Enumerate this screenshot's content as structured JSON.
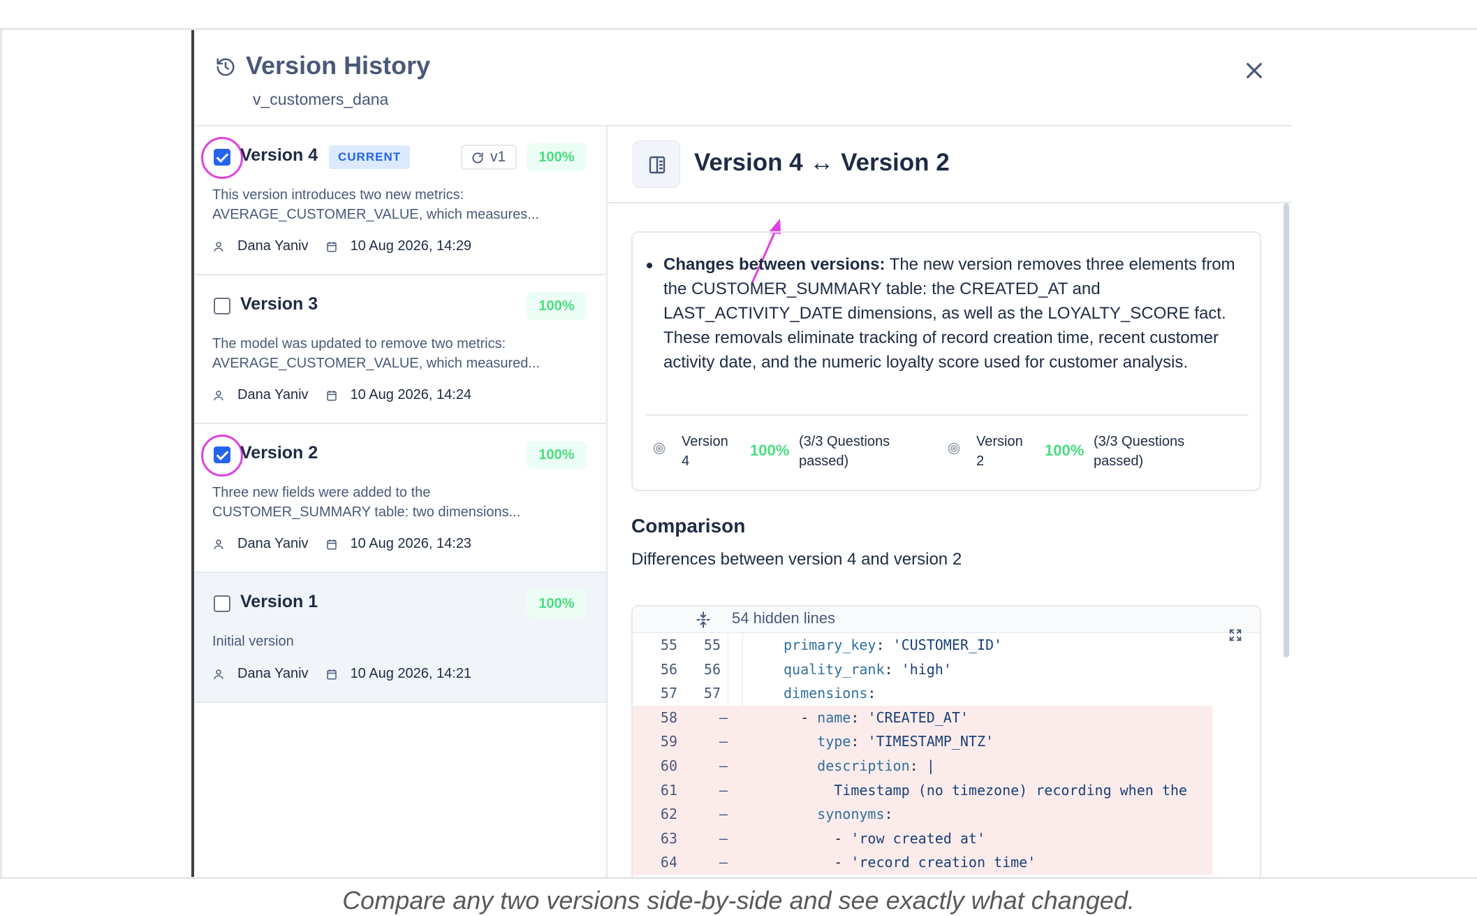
{
  "header": {
    "title": "Version History",
    "subtitle": "v_customers_dana"
  },
  "versions": [
    {
      "name": "Version 4",
      "badge": "CURRENT",
      "restore_label": "v1",
      "score": "100%",
      "description": "This version introduces two new metrics: AVERAGE_CUSTOMER_VALUE, which measures...",
      "author": "Dana Yaniv",
      "date": "10 Aug 2026, 14:29",
      "checked": true
    },
    {
      "name": "Version 3",
      "score": "100%",
      "description": "The model was updated to remove two metrics: AVERAGE_CUSTOMER_VALUE, which measured...",
      "author": "Dana Yaniv",
      "date": "10 Aug 2026, 14:24",
      "checked": false
    },
    {
      "name": "Version 2",
      "score": "100%",
      "description": "Three new fields were added to the CUSTOMER_SUMMARY table: two dimensions...",
      "author": "Dana Yaniv",
      "date": "10 Aug 2026, 14:23",
      "checked": true
    },
    {
      "name": "Version 1",
      "score": "100%",
      "description": "Initial version",
      "author": "Dana Yaniv",
      "date": "10 Aug 2026, 14:21",
      "checked": false
    }
  ],
  "compare": {
    "title": "Version 4 ↔ Version 2",
    "summary_label": "Changes between versions:",
    "summary_text": " The new version removes three elements from the CUSTOMER_SUMMARY table: the CREATED_AT and LAST_ACTIVITY_DATE dimensions, as well as the LOYALTY_SCORE fact. These removals eliminate tracking of record creation time, recent customer activity date, and the numeric loyalty score used for customer analysis.",
    "stats": [
      {
        "label": "Version 4",
        "pct": "100%",
        "questions": "(3/3 Questions passed)"
      },
      {
        "label": "Version 2",
        "pct": "100%",
        "questions": "(3/3 Questions passed)"
      }
    ],
    "comparison_heading": "Comparison",
    "comparison_sub": "Differences between version 4 and version 2",
    "hidden_lines": "54 hidden lines",
    "code_lines": [
      {
        "a": "55",
        "b": "55",
        "mark": "",
        "indent": "",
        "key": "primary_key",
        "value": "'CUSTOMER_ID'",
        "del": false
      },
      {
        "a": "56",
        "b": "56",
        "mark": "",
        "indent": "",
        "key": "quality_rank",
        "value": "'high'",
        "del": false
      },
      {
        "a": "57",
        "b": "57",
        "mark": "",
        "indent": "",
        "key": "dimensions",
        "value": "",
        "del": false
      },
      {
        "a": "58",
        "b": "",
        "mark": "—",
        "indent": "  - ",
        "key": "name",
        "value": "'CREATED_AT'",
        "del": true
      },
      {
        "a": "59",
        "b": "",
        "mark": "—",
        "indent": "    ",
        "key": "type",
        "value": "'TIMESTAMP_NTZ'",
        "del": true
      },
      {
        "a": "60",
        "b": "",
        "mark": "—",
        "indent": "    ",
        "key": "description",
        "value": "|",
        "del": true
      },
      {
        "a": "61",
        "b": "",
        "mark": "—",
        "indent": "      ",
        "key": "",
        "value": "Timestamp (no timezone) recording when the",
        "del": true
      },
      {
        "a": "62",
        "b": "",
        "mark": "—",
        "indent": "    ",
        "key": "synonyms",
        "value": "",
        "del": true
      },
      {
        "a": "63",
        "b": "",
        "mark": "—",
        "indent": "      - ",
        "key": "",
        "value": "'row created at'",
        "del": true
      },
      {
        "a": "64",
        "b": "",
        "mark": "—",
        "indent": "      - ",
        "key": "",
        "value": "'record creation time'",
        "del": true
      }
    ]
  },
  "caption": "Compare any two versions side-by-side and see exactly what changed.",
  "colors": {
    "accent": "#2563eb",
    "highlight_ring": "#e040e0",
    "success": "#4ade80",
    "deleted_row": "#fbeceb"
  },
  "icons": [
    "history-icon",
    "close-icon",
    "restore-icon",
    "user-icon",
    "calendar-icon",
    "compare-icon",
    "target-icon",
    "unfold-icon",
    "expand-icon"
  ]
}
